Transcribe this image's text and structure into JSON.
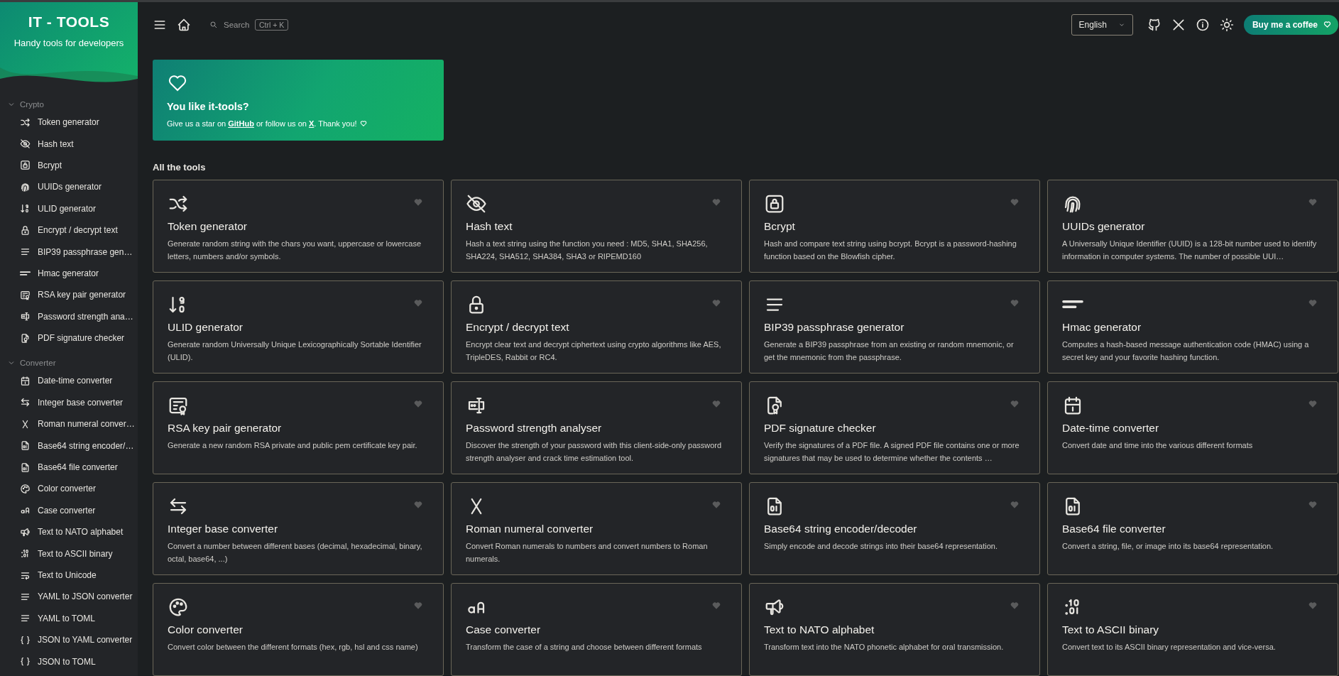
{
  "sidebar": {
    "logo_title": "IT - TOOLS",
    "logo_subtitle": "Handy tools for developers",
    "sections": [
      {
        "title": "Crypto",
        "expanded": true,
        "items": [
          {
            "label": "Token generator",
            "kind": "shuffle"
          },
          {
            "label": "Hash text",
            "kind": "eye-off"
          },
          {
            "label": "Bcrypt",
            "kind": "lock-box"
          },
          {
            "label": "UUIDs generator",
            "kind": "fingerprint"
          },
          {
            "label": "ULID generator",
            "kind": "sort-numeric"
          },
          {
            "label": "Encrypt / decrypt text",
            "kind": "lock"
          },
          {
            "label": "BIP39 passphrase gen…",
            "kind": "lines"
          },
          {
            "label": "Hmac generator",
            "kind": "short-lines"
          },
          {
            "label": "RSA key pair generator",
            "kind": "certificate"
          },
          {
            "label": "Password strength ana…",
            "kind": "password"
          },
          {
            "label": "PDF signature checker",
            "kind": "file-cert"
          }
        ]
      },
      {
        "title": "Converter",
        "expanded": true,
        "items": [
          {
            "label": "Date-time converter",
            "kind": "calendar"
          },
          {
            "label": "Integer base converter",
            "kind": "arrows"
          },
          {
            "label": "Roman numeral conver…",
            "kind": "x-letter"
          },
          {
            "label": "Base64 string encoder/…",
            "kind": "file-binary"
          },
          {
            "label": "Base64 file converter",
            "kind": "file-binary"
          },
          {
            "label": "Color converter",
            "kind": "palette"
          },
          {
            "label": "Case converter",
            "kind": "case"
          },
          {
            "label": "Text to NATO alphabet",
            "kind": "megaphone"
          },
          {
            "label": "Text to ASCII binary",
            "kind": "binary"
          },
          {
            "label": "Text to Unicode",
            "kind": "text-wrap"
          },
          {
            "label": "YAML to JSON converter",
            "kind": "lines"
          },
          {
            "label": "YAML to TOML",
            "kind": "lines"
          },
          {
            "label": "JSON to YAML converter",
            "kind": "braces"
          },
          {
            "label": "JSON to TOML",
            "kind": "braces"
          }
        ]
      }
    ]
  },
  "header": {
    "search_placeholder": "Search",
    "search_shortcut": "Ctrl + K",
    "language": "English",
    "coffee_button": "Buy me a coffee"
  },
  "banner": {
    "title": "You like it-tools?",
    "text_before": "Give us a star on",
    "github_link": "GitHub",
    "text_middle": "or follow us on",
    "x_link": "X",
    "text_after": ". Thank you!"
  },
  "section_title": "All the tools",
  "tools": [
    {
      "title": "Token generator",
      "kind": "shuffle",
      "favorite": false,
      "description": "Generate random string with the chars you want, uppercase or lowercase letters, numbers and/or symbols."
    },
    {
      "title": "Hash text",
      "kind": "eye-off",
      "favorite": false,
      "description": "Hash a text string using the function you need : MD5, SHA1, SHA256, SHA224, SHA512, SHA384, SHA3 or RIPEMD160"
    },
    {
      "title": "Bcrypt",
      "kind": "lock-box",
      "favorite": false,
      "description": "Hash and compare text string using bcrypt. Bcrypt is a password-hashing function based on the Blowfish cipher."
    },
    {
      "title": "UUIDs generator",
      "kind": "fingerprint",
      "favorite": false,
      "description": "A Universally Unique Identifier (UUID) is a 128-bit number used to identify information in computer systems. The number of possible UUI…"
    },
    {
      "title": "ULID generator",
      "kind": "sort-numeric",
      "favorite": false,
      "description": "Generate random Universally Unique Lexicographically Sortable Identifier (ULID)."
    },
    {
      "title": "Encrypt / decrypt text",
      "kind": "lock",
      "favorite": false,
      "description": "Encrypt clear text and decrypt ciphertext using crypto algorithms like AES, TripleDES, Rabbit or RC4."
    },
    {
      "title": "BIP39 passphrase generator",
      "kind": "lines",
      "favorite": false,
      "description": "Generate a BIP39 passphrase from an existing or random mnemonic, or get the mnemonic from the passphrase."
    },
    {
      "title": "Hmac generator",
      "kind": "short-lines",
      "favorite": false,
      "description": "Computes a hash-based message authentication code (HMAC) using a secret key and your favorite hashing function."
    },
    {
      "title": "RSA key pair generator",
      "kind": "certificate",
      "favorite": false,
      "description": "Generate a new random RSA private and public pem certificate key pair."
    },
    {
      "title": "Password strength analyser",
      "kind": "password",
      "favorite": false,
      "description": "Discover the strength of your password with this client-side-only password strength analyser and crack time estimation tool."
    },
    {
      "title": "PDF signature checker",
      "kind": "file-cert",
      "favorite": false,
      "description": "Verify the signatures of a PDF file. A signed PDF file contains one or more signatures that may be used to determine whether the contents …"
    },
    {
      "title": "Date-time converter",
      "kind": "calendar",
      "favorite": false,
      "description": "Convert date and time into the various different formats"
    },
    {
      "title": "Integer base converter",
      "kind": "arrows",
      "favorite": false,
      "description": "Convert a number between different bases (decimal, hexadecimal, binary, octal, base64, ...)"
    },
    {
      "title": "Roman numeral converter",
      "kind": "x-letter",
      "favorite": false,
      "description": "Convert Roman numerals to numbers and convert numbers to Roman numerals."
    },
    {
      "title": "Base64 string encoder/decoder",
      "kind": "file-binary",
      "favorite": false,
      "description": "Simply encode and decode strings into their base64 representation."
    },
    {
      "title": "Base64 file converter",
      "kind": "file-binary",
      "favorite": false,
      "description": "Convert a string, file, or image into its base64 representation."
    },
    {
      "title": "Color converter",
      "kind": "palette",
      "favorite": false,
      "description": "Convert color between the different formats (hex, rgb, hsl and css name)"
    },
    {
      "title": "Case converter",
      "kind": "case",
      "favorite": false,
      "description": "Transform the case of a string and choose between different formats"
    },
    {
      "title": "Text to NATO alphabet",
      "kind": "megaphone",
      "favorite": false,
      "description": "Transform text into the NATO phonetic alphabet for oral transmission."
    },
    {
      "title": "Text to ASCII binary",
      "kind": "binary",
      "favorite": false,
      "description": "Convert text to its ASCII binary representation and vice-versa."
    }
  ]
}
